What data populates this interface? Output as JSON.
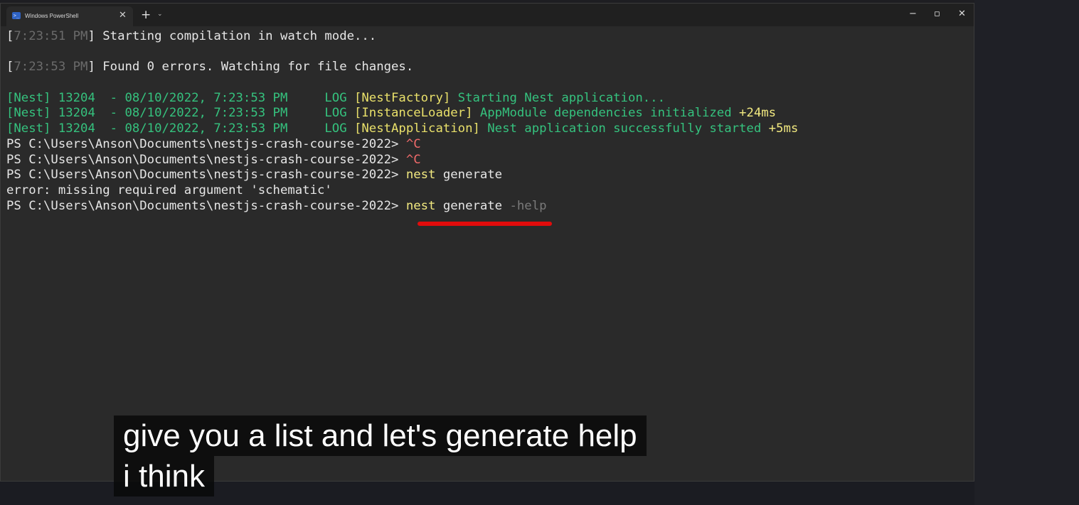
{
  "window": {
    "tab_title": "Windows PowerShell",
    "tab_icon": "powershell-icon",
    "tab_close": "✕",
    "new_tab": "+",
    "dropdown": "⌄",
    "minimize": "−",
    "maximize": "▫",
    "close": "✕"
  },
  "terminal": {
    "lines": [
      [
        {
          "t": "[",
          "c": "white"
        },
        {
          "t": "7:23:51 PM",
          "c": "dim"
        },
        {
          "t": "] Starting compilation in watch mode...",
          "c": "white"
        }
      ],
      [
        {
          "t": " ",
          "c": "white"
        }
      ],
      [
        {
          "t": "[",
          "c": "white"
        },
        {
          "t": "7:23:53 PM",
          "c": "dim"
        },
        {
          "t": "] Found 0 errors. Watching for file changes.",
          "c": "white"
        }
      ],
      [
        {
          "t": " ",
          "c": "white"
        }
      ],
      [
        {
          "t": "[Nest] 13204  - 08/10/2022, 7:23:53 PM     LOG ",
          "c": "green"
        },
        {
          "t": "[NestFactory]",
          "c": "yellow"
        },
        {
          "t": " Starting Nest application...",
          "c": "green"
        }
      ],
      [
        {
          "t": "[Nest] 13204  - 08/10/2022, 7:23:53 PM     LOG ",
          "c": "green"
        },
        {
          "t": "[InstanceLoader]",
          "c": "yellow"
        },
        {
          "t": " AppModule dependencies initialized ",
          "c": "green"
        },
        {
          "t": "+24ms",
          "c": "lyellow"
        }
      ],
      [
        {
          "t": "[Nest] 13204  - 08/10/2022, 7:23:53 PM     LOG ",
          "c": "green"
        },
        {
          "t": "[NestApplication]",
          "c": "yellow"
        },
        {
          "t": " Nest application successfully started ",
          "c": "green"
        },
        {
          "t": "+5ms",
          "c": "lyellow"
        }
      ],
      [
        {
          "t": "PS C:\\Users\\Anson\\Documents\\nestjs-crash-course-2022> ",
          "c": "white"
        },
        {
          "t": "^C",
          "c": "red"
        }
      ],
      [
        {
          "t": "PS C:\\Users\\Anson\\Documents\\nestjs-crash-course-2022> ",
          "c": "white"
        },
        {
          "t": "^C",
          "c": "red"
        }
      ],
      [
        {
          "t": "PS C:\\Users\\Anson\\Documents\\nestjs-crash-course-2022> ",
          "c": "white"
        },
        {
          "t": "nest",
          "c": "lyellow"
        },
        {
          "t": " generate",
          "c": "white"
        }
      ],
      [
        {
          "t": "error: missing required argument 'schematic'",
          "c": "white"
        }
      ],
      [
        {
          "t": "PS C:\\Users\\Anson\\Documents\\nestjs-crash-course-2022> ",
          "c": "white"
        },
        {
          "t": "nest",
          "c": "lyellow"
        },
        {
          "t": " generate ",
          "c": "white"
        },
        {
          "t": "-help",
          "c": "gray"
        }
      ]
    ]
  },
  "captions": {
    "line1": "give you a list and let's generate help",
    "line2": "i think"
  },
  "colors": {
    "terminal_bg": "#2a2a2a",
    "titlebar_bg": "#202020",
    "log_green": "#35c27e",
    "context_yellow": "#e9e06a",
    "error_red": "#f06a6a",
    "underline_red": "#e10c0c"
  }
}
